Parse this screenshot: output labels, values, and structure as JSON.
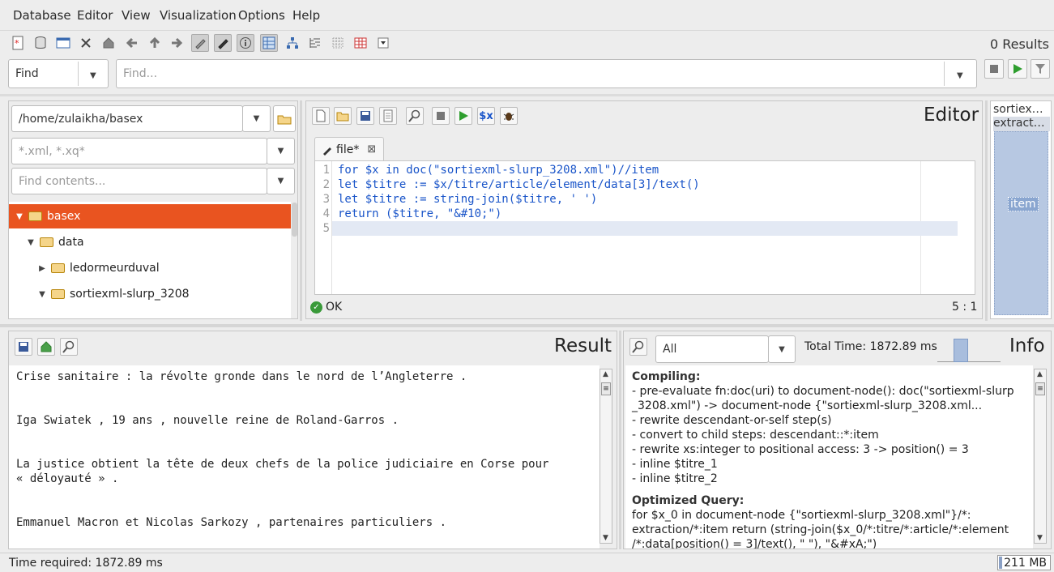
{
  "menu": [
    "Database",
    "Editor",
    "View",
    "Visualization",
    "Options",
    "Help"
  ],
  "toolbar": {
    "icons": [
      "new-database-icon",
      "open-database-icon",
      "database-properties-icon",
      "close-database-icon",
      "home-icon",
      "back-icon",
      "up-icon",
      "forward-icon",
      "edit-icon",
      "text-view-icon",
      "info-view-icon",
      "map-view-icon",
      "tree-view-icon",
      "folder-view-icon",
      "plot-view-icon",
      "table-view-icon",
      "more-views-icon"
    ],
    "results_count": "0 Results"
  },
  "search": {
    "mode": "Find",
    "placeholder": "Find..."
  },
  "filebrowser": {
    "path": "/home/zulaikha/basex",
    "filter_placeholder": "*.xml, *.xq*",
    "contents_placeholder": "Find contents...",
    "tree": [
      {
        "label": "basex",
        "level": 0,
        "expanded": true,
        "selected": true
      },
      {
        "label": "data",
        "level": 1,
        "expanded": true,
        "selected": false
      },
      {
        "label": "ledormeurduval",
        "level": 2,
        "expanded": false,
        "selected": false
      },
      {
        "label": "sortiexml-slurp_3208",
        "level": 2,
        "expanded": true,
        "selected": false
      }
    ]
  },
  "editor": {
    "title": "Editor",
    "tab_label": "file*",
    "lines": [
      "for $x in doc(\"sortiexml-slurp_3208.xml\")//item",
      "let $titre := $x/titre/article/element/data[3]/text()",
      "let $titre := string-join($titre, ' ')",
      "return ($titre, \"&#10;\")",
      ""
    ],
    "line_numbers": [
      "1",
      "2",
      "3",
      "4",
      "5"
    ],
    "status": "OK",
    "cursor": "5 : 1"
  },
  "side_panel": {
    "items": [
      "sortiex…",
      "extract…"
    ],
    "node": "item"
  },
  "result": {
    "title": "Result",
    "lines": [
      "Crise sanitaire : la révolte gronde dans le nord de l’Angleterre .",
      "Iga Swiatek , 19 ans , nouvelle reine de Roland-Garros .",
      "La justice obtient la tête de deux chefs de la police judiciaire en Corse pour",
      "« déloyauté » .",
      "Emmanuel Macron et Nicolas Sarkozy , partenaires particuliers ."
    ]
  },
  "info": {
    "title": "Info",
    "filter": "All",
    "total_time": "Total Time: 1872.89 ms",
    "compiling_heading": "Compiling:",
    "compiling_lines": [
      "- pre-evaluate fn:doc(uri) to document-node(): doc(\"sortiexml-slurp",
      "_3208.xml\") -> document-node {\"sortiexml-slurp_3208.xml...",
      "- rewrite descendant-or-self step(s)",
      "- convert to child steps: descendant::*:item",
      "- rewrite xs:integer to positional access: 3 -> position() = 3",
      "- inline $titre_1",
      "- inline $titre_2"
    ],
    "optimized_heading": "Optimized Query:",
    "optimized_lines": [
      "for $x_0 in document-node {\"sortiexml-slurp_3208.xml\"}/*:",
      "extraction/*:item return (string-join($x_0/*:titre/*:article/*:element",
      "/*:data[position() = 3]/text(), \" \"), \"&#xA;\")"
    ]
  },
  "statusbar": {
    "time": "Time required: 1872.89 ms",
    "memory": "211 MB"
  },
  "colors": {
    "selection": "#e95420",
    "keyword": "#1a55c9",
    "ok": "#3a9a3a",
    "map_fill": "#b7c8e2"
  }
}
